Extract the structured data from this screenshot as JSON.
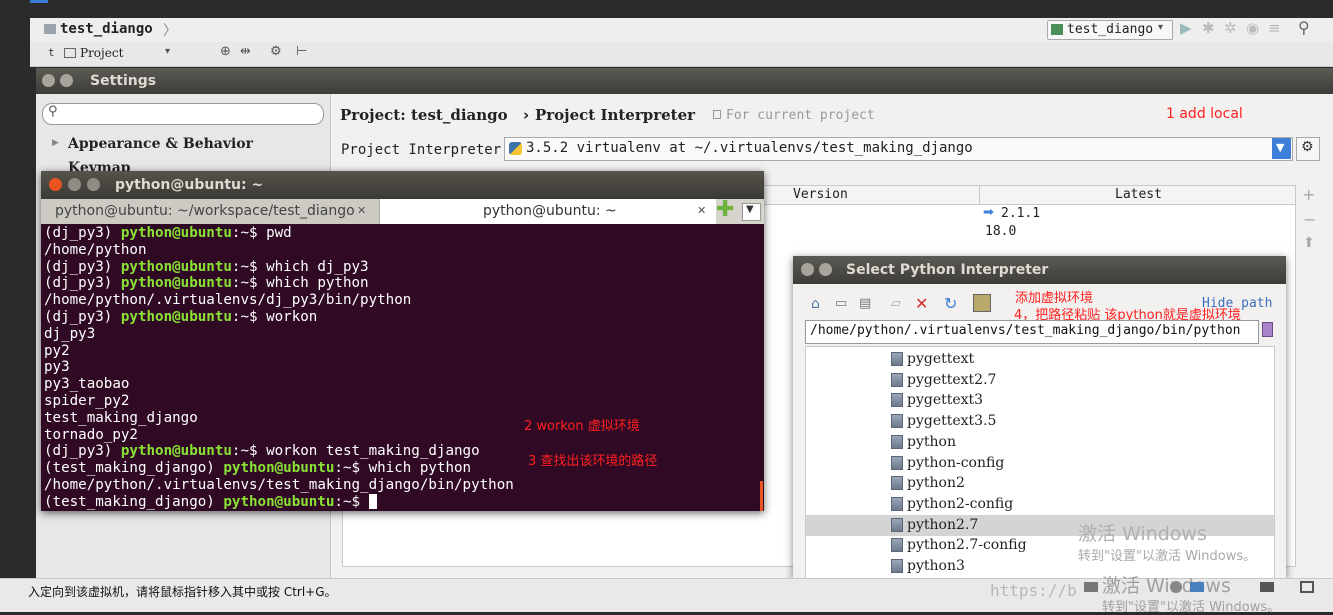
{
  "ide": {
    "project_crumb": "test_diango",
    "project_tab": "Project",
    "run_config": "test_diango"
  },
  "settings": {
    "title": "Settings",
    "search_placeholder": "",
    "tree": [
      {
        "label": "Appearance & Behavior"
      },
      {
        "label": "Keymap"
      }
    ],
    "breadcrumb_project": "Project: test_diango",
    "breadcrumb_sep": "›",
    "breadcrumb_page": "Project Interpreter",
    "for_current": "For current project",
    "interpreter_label": "Project Interpreter:",
    "interpreter_value": "3.5.2 virtualenv at ~/.virtualenvs/test_making_django",
    "table_headers": [
      "Version",
      "Latest"
    ],
    "table_rows": [
      {
        "latest": "2.1.1",
        "has_upgrade": true
      },
      {
        "latest": "18.0",
        "has_upgrade": false
      }
    ]
  },
  "annotations": {
    "a1": "1 add local",
    "a2": "2 workon  虚拟环境",
    "a3": "3 查找出该环境的路径",
    "a4_line1": "添加虚拟环境",
    "a4_line2": "4，把路径粘贴 该python就是虚拟环境"
  },
  "terminal": {
    "title": "python@ubuntu: ~",
    "tabs": [
      "python@ubuntu: ~/workspace/test_diango",
      "python@ubuntu: ~"
    ],
    "lines": [
      {
        "pre": "(dj_py3) ",
        "prompt": "python@ubuntu",
        "post": ":~$ pwd"
      },
      {
        "text": "/home/python"
      },
      {
        "pre": "(dj_py3) ",
        "prompt": "python@ubuntu",
        "post": ":~$ which dj_py3"
      },
      {
        "pre": "(dj_py3) ",
        "prompt": "python@ubuntu",
        "post": ":~$ which python"
      },
      {
        "text": "/home/python/.virtualenvs/dj_py3/bin/python"
      },
      {
        "pre": "(dj_py3) ",
        "prompt": "python@ubuntu",
        "post": ":~$ workon"
      },
      {
        "text": "dj_py3"
      },
      {
        "text": "py2"
      },
      {
        "text": "py3"
      },
      {
        "text": "py3_taobao"
      },
      {
        "text": "spider_py2"
      },
      {
        "text": "test_making_django"
      },
      {
        "text": "tornado_py2"
      },
      {
        "pre": "(dj_py3) ",
        "prompt": "python@ubuntu",
        "post": ":~$ workon test_making_django"
      },
      {
        "pre": "(test_making_django) ",
        "prompt": "python@ubuntu",
        "post": ":~$ which python"
      },
      {
        "text": "/home/python/.virtualenvs/test_making_django/bin/python"
      },
      {
        "pre": "(test_making_django) ",
        "prompt": "python@ubuntu",
        "post": ":~$ "
      }
    ]
  },
  "interpreter_dialog": {
    "title": "Select Python Interpreter",
    "hide_path": "Hide path",
    "path_value": "/home/python/.virtualenvs/test_making_django/bin/python",
    "files": [
      "pygettext",
      "pygettext2.7",
      "pygettext3",
      "pygettext3.5",
      "python",
      "python-config",
      "python2",
      "python2-config",
      "python2.7",
      "python2.7-config",
      "python3"
    ],
    "selected_index": 8
  },
  "watermark": {
    "activate_title": "激活 Windows",
    "activate_sub": "转到\"设置\"以激活 Windows。",
    "activate_title2": "激活 Windows",
    "activate_sub2": "转到\"设置\"以激活 Windows。",
    "url": "https://b"
  },
  "status": {
    "vm_hint": "入定向到该虚拟机，请将鼠标指针移入其中或按 Ctrl+G。"
  }
}
